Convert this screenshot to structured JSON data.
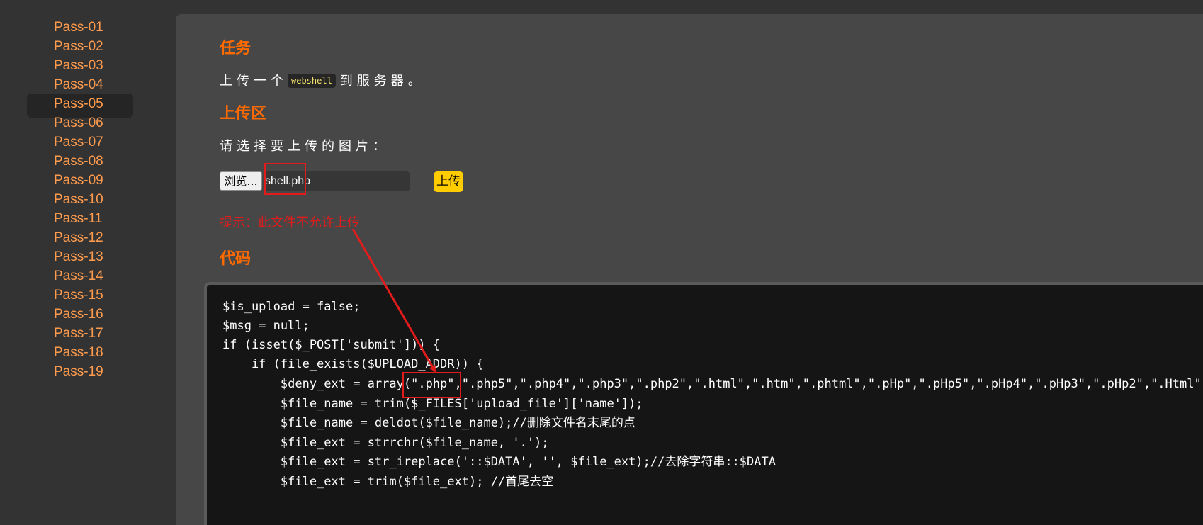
{
  "sidebar": {
    "items": [
      {
        "label": "Pass-01"
      },
      {
        "label": "Pass-02"
      },
      {
        "label": "Pass-03"
      },
      {
        "label": "Pass-04"
      },
      {
        "label": "Pass-05"
      },
      {
        "label": "Pass-06"
      },
      {
        "label": "Pass-07"
      },
      {
        "label": "Pass-08"
      },
      {
        "label": "Pass-09"
      },
      {
        "label": "Pass-10"
      },
      {
        "label": "Pass-11"
      },
      {
        "label": "Pass-12"
      },
      {
        "label": "Pass-13"
      },
      {
        "label": "Pass-14"
      },
      {
        "label": "Pass-15"
      },
      {
        "label": "Pass-16"
      },
      {
        "label": "Pass-17"
      },
      {
        "label": "Pass-18"
      },
      {
        "label": "Pass-19"
      }
    ],
    "active_label": "Pass-05"
  },
  "task": {
    "title": "任务",
    "text_before": "上传一个",
    "code_word": "webshell",
    "text_after": "到服务器。"
  },
  "upload": {
    "title": "上传区",
    "prompt": "请选择要上传的图片：",
    "browse_label": "浏览...",
    "file_name": "shell.php",
    "submit_label": "上传",
    "hint": "提示：此文件不允许上传"
  },
  "code": {
    "title": "代码",
    "lines": [
      "$is_upload = false;",
      "$msg = null;",
      "if (isset($_POST['submit'])) {",
      "    if (file_exists($UPLOAD_ADDR)) {",
      "        $deny_ext = array(\".php\",\".php5\",\".php4\",\".php3\",\".php2\",\".html\",\".htm\",\".phtml\",\".pHp\",\".pHp5\",\".pHp4\",\".pHp3\",\".pHp2\",\".Html\",\".Htm\",\".pHtml\");",
      "        $file_name = trim($_FILES['upload_file']['name']);",
      "        $file_name = deldot($file_name);//删除文件名末尾的点",
      "        $file_ext = strrchr($file_name, '.');",
      "        $file_ext = str_ireplace('::$DATA', '', $file_ext);//去除字符串::$DATA",
      "        $file_ext = trim($file_ext); //首尾去空"
    ]
  },
  "colors": {
    "accent": "#ff6a00",
    "nav_link": "#ff9b4d",
    "warning": "#e01c1c",
    "annotation": "#e31b1b",
    "button": "#ffcc00"
  }
}
